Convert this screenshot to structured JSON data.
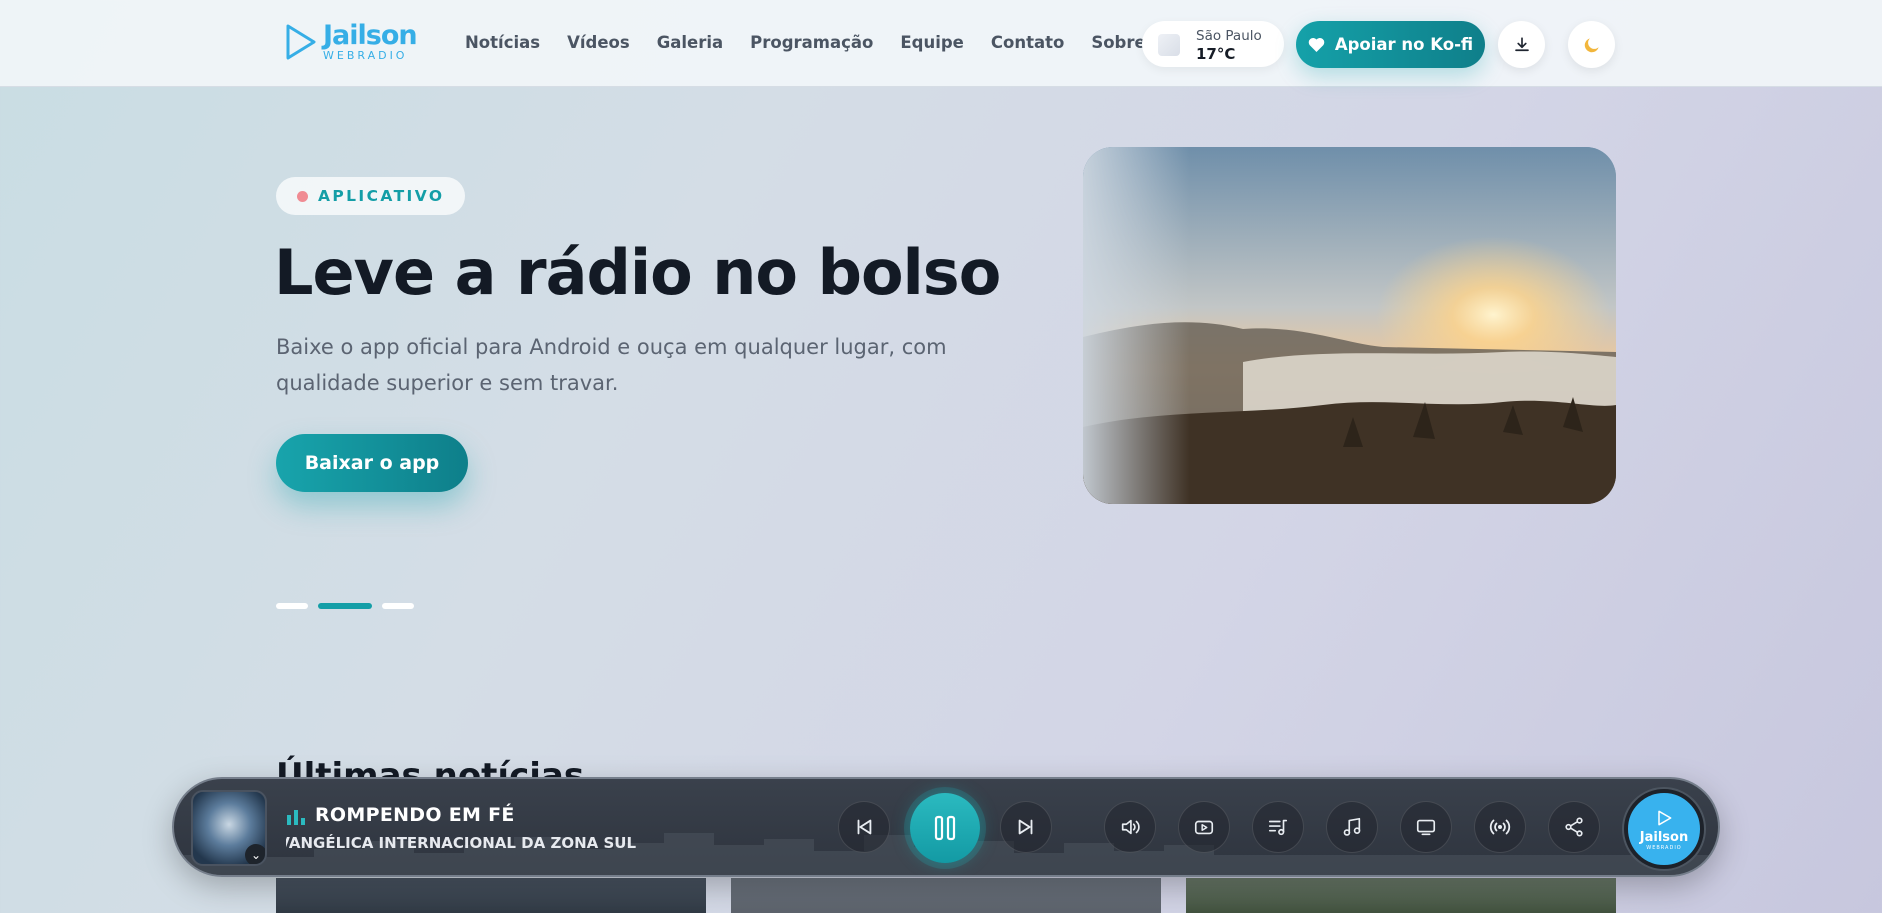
{
  "header": {
    "logo": {
      "name": "Jailson",
      "subtitle": "WEBRADIO"
    },
    "nav": [
      "Notícias",
      "Vídeos",
      "Galeria",
      "Programação",
      "Equipe",
      "Contato",
      "Sobre"
    ],
    "weather": {
      "city": "São Paulo",
      "temp": "17°C"
    },
    "kofi_label": "Apoiar no Ko-fi",
    "icons": {
      "download": "download-icon",
      "theme": "moon-icon"
    }
  },
  "hero": {
    "badge": "APLICATIVO",
    "title": "Leve a rádio no bolso",
    "subtitle": "Baixe o app oficial para Android e ouça em qualquer lugar, com qualidade superior e sem travar.",
    "cta": "Baixar o app",
    "slides": {
      "count": 3,
      "active_index": 1
    }
  },
  "news": {
    "heading": "Últimas notícias"
  },
  "player": {
    "title": "ROMPENDO EM FÉ",
    "artist": "E EVANGÉLICA INTERNACIONAL DA ZONA SUL",
    "state": "playing",
    "controls": [
      "previous-icon",
      "pause-icon",
      "next-icon",
      "volume-icon",
      "video-icon",
      "playlist-icon",
      "music-note-icon",
      "tv-icon",
      "broadcast-icon",
      "share-icon"
    ],
    "logo": {
      "name": "Jailson",
      "subtitle": "WEBRADIO"
    }
  },
  "colors": {
    "accent": "#149ea7",
    "brand_blue": "#38b2ee",
    "player_bg": "#343a44"
  }
}
